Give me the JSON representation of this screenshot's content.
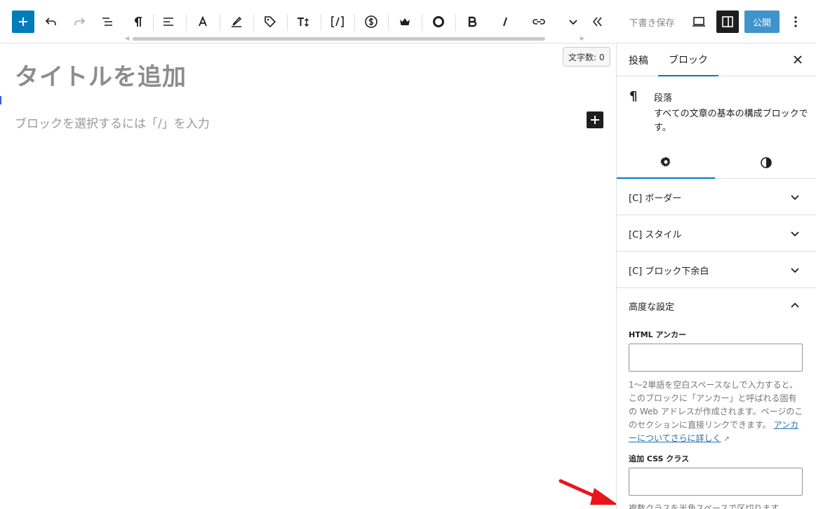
{
  "toolbar": {
    "icons": [
      "plus-icon",
      "undo-icon",
      "redo-icon",
      "list-view-icon",
      "paragraph-icon",
      "align-left-icon",
      "text-a-icon",
      "highlighter-icon",
      "tag-icon",
      "font-size-icon",
      "shortcode-icon",
      "dollar-icon",
      "crown-icon",
      "circle-icon",
      "bold-icon",
      "italic-icon",
      "link-icon",
      "chevron-down-icon",
      "double-chevron-left-icon"
    ],
    "save_draft": "下書き保存",
    "publish": "公開"
  },
  "editor": {
    "word_count": "文字数: 0",
    "title_placeholder": "タイトルを追加",
    "block_placeholder": "ブロックを選択するには「/」を入力"
  },
  "sidebar": {
    "tabs": [
      "投稿",
      "ブロック"
    ],
    "active_tab": "ブロック",
    "block": {
      "icon": "¶",
      "name": "段落",
      "description": "すべての文章の基本の構成ブロックです。"
    },
    "panels": [
      {
        "title": "[C] ボーダー"
      },
      {
        "title": "[C] スタイル"
      },
      {
        "title": "[C] ブロック下余白"
      }
    ],
    "advanced": {
      "title": "高度な設定",
      "html_anchor_label": "HTML アンカー",
      "html_anchor_value": "",
      "help_text": "1〜2単語を空白スペースなしで入力すると、このブロックに「アンカー」と呼ばれる固有の Web アドレスが作成されます。ページのこのセクションに直接リンクできます。",
      "help_link": "アンカーについてさらに詳しく",
      "css_class_label": "追加 CSS クラス",
      "css_class_value": "",
      "css_help": "複数クラスを半角スペースで区切ります。"
    }
  },
  "colors": {
    "accent": "#007cba",
    "publish": "#3f94cc",
    "arrow": "#e8161b"
  }
}
